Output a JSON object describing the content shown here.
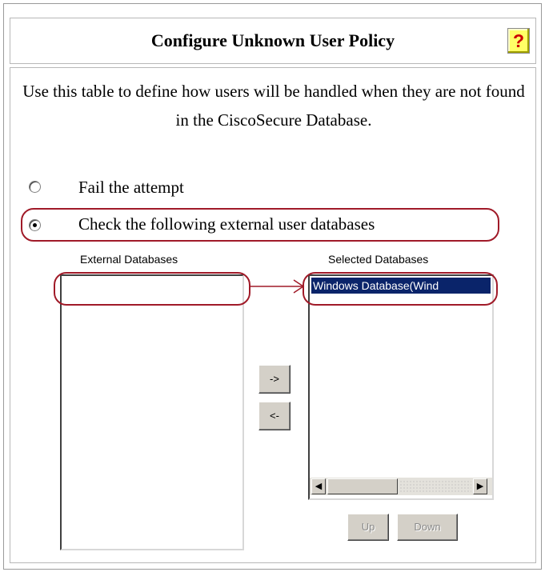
{
  "page": {
    "title": "Configure Unknown User Policy",
    "help_icon": "question-mark",
    "description": "Use this table to define how users will be handled when they are not found in the CiscoSecure Database."
  },
  "options": [
    {
      "label": "Fail the attempt",
      "checked": false
    },
    {
      "label": "Check the following external user databases",
      "checked": true
    }
  ],
  "external_databases": {
    "label": "External Databases",
    "items": []
  },
  "selected_databases": {
    "label": "Selected Databases",
    "items": [
      "Windows Database(Wind"
    ]
  },
  "buttons": {
    "add": "->",
    "remove": "<-",
    "up": "Up",
    "down": "Down"
  },
  "annotation": {
    "color": "#a01a28"
  }
}
